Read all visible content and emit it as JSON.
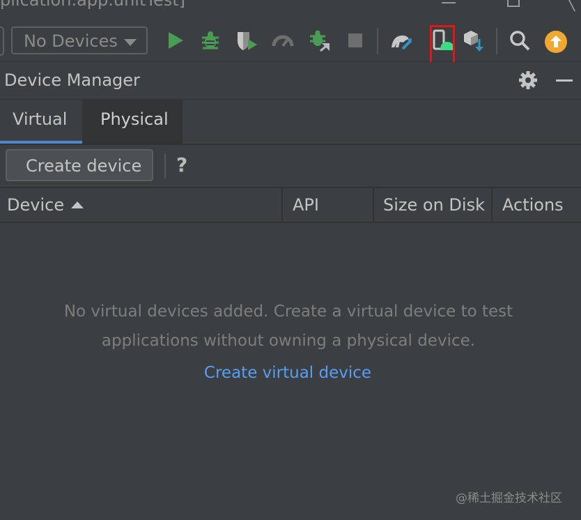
{
  "window": {
    "title": "plication.app.unitTest]"
  },
  "toolbar": {
    "device_selector_value": "No Devices",
    "icons": [
      "run-icon",
      "debug-icon",
      "coverage-icon",
      "profile-icon",
      "attach-debugger-icon",
      "stop-icon",
      "gradle-sync-icon",
      "device-manager-icon",
      "sdk-manager-icon",
      "search-icon",
      "update-icon"
    ],
    "colors": {
      "run": "#499c54",
      "highlight": "#e0161c",
      "update": "#f0a830"
    }
  },
  "device_manager": {
    "title": "Device Manager",
    "tabs": [
      {
        "label": "Virtual",
        "selected": true
      },
      {
        "label": "Physical",
        "selected": false
      }
    ],
    "create_button": "Create device",
    "help_label": "?",
    "columns": [
      "Device",
      "API",
      "Size on Disk",
      "Actions"
    ],
    "sort_column": "Device",
    "empty_line1": "No virtual devices added. Create a virtual device to test",
    "empty_line2": "applications without owning a physical device.",
    "empty_link": "Create virtual device"
  },
  "watermark": "@稀土掘金技术社区"
}
